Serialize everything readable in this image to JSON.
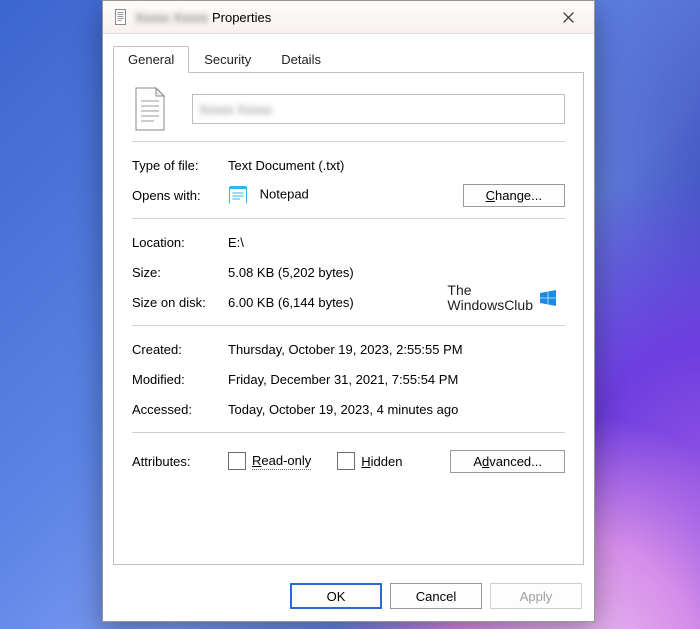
{
  "titlebar": {
    "filename_obscured": "Xxxxx Xxxxx",
    "suffix": "Properties"
  },
  "tabs": {
    "general": "General",
    "security": "Security",
    "details": "Details"
  },
  "general": {
    "filename_obscured": "Xxxxx Xxxxx",
    "type_of_file_label": "Type of file:",
    "type_of_file_value": "Text Document (.txt)",
    "opens_with_label": "Opens with:",
    "opens_with_app": "Notepad",
    "change_button": "Change...",
    "location_label": "Location:",
    "location_value": "E:\\",
    "size_label": "Size:",
    "size_value": "5.08 KB (5,202 bytes)",
    "size_on_disk_label": "Size on disk:",
    "size_on_disk_value": "6.00 KB (6,144 bytes)",
    "created_label": "Created:",
    "created_value": "Thursday, October 19, 2023, 2:55:55 PM",
    "modified_label": "Modified:",
    "modified_value": "Friday, December 31, 2021, 7:55:54 PM",
    "accessed_label": "Accessed:",
    "accessed_value": "Today, October 19, 2023, 4 minutes ago",
    "attributes_label": "Attributes:",
    "read_only_label": "Read-only",
    "hidden_label": "Hidden",
    "advanced_button": "Advanced..."
  },
  "watermark": {
    "line1": "The",
    "line2": "WindowsClub"
  },
  "buttons": {
    "ok": "OK",
    "cancel": "Cancel",
    "apply": "Apply"
  }
}
